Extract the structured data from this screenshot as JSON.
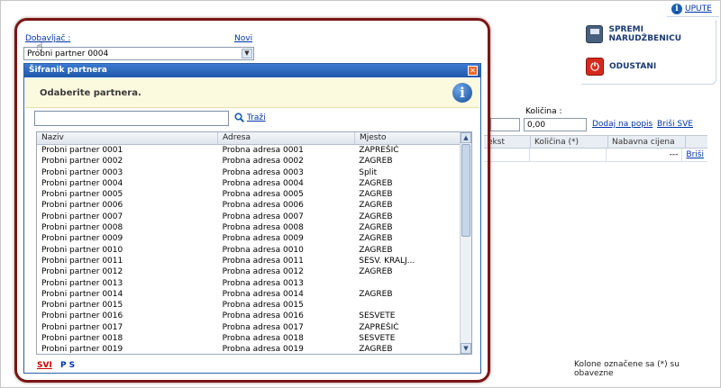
{
  "upute_label": "UPUTE",
  "actions": {
    "save_label": "SPREMI NARUDŽBENICU",
    "cancel_label": "ODUSTANI"
  },
  "quantity": {
    "label": "Količina :",
    "value": "0,00",
    "add_link": "Dodaj na popis",
    "delete_all_link": "Briši SVE"
  },
  "background_table": {
    "columns": [
      "ekst",
      "Količina (*)",
      "Nabavna cijena"
    ],
    "row_value": "---",
    "row_delete": "Briši"
  },
  "footer_note": "Kolone označene sa (*) su obavezne",
  "supplier": {
    "label": "Dobavljač :",
    "new_link": "Novi",
    "selected": "Probni partner 0004"
  },
  "dialog": {
    "title": "Šifranik partnera",
    "message": "Odaberite partnera.",
    "search_value": "",
    "search_button": "Traži",
    "columns": [
      "Naziv",
      "Adresa",
      "Mjesto"
    ],
    "rows": [
      [
        "Probni partner 0001",
        "Probna adresa 0001",
        "ZAPREŠIĆ"
      ],
      [
        "Probni partner 0002",
        "Probna adresa 0002",
        "ZAGREB"
      ],
      [
        "Probni partner 0003",
        "Probna adresa 0003",
        "Split"
      ],
      [
        "Probni partner 0004",
        "Probna adresa 0004",
        "ZAGREB"
      ],
      [
        "Probni partner 0005",
        "Probna adresa 0005",
        "ZAGREB"
      ],
      [
        "Probni partner 0006",
        "Probna adresa 0006",
        "ZAGREB"
      ],
      [
        "Probni partner 0007",
        "Probna adresa 0007",
        "ZAGREB"
      ],
      [
        "Probni partner 0008",
        "Probna adresa 0008",
        "ZAGREB"
      ],
      [
        "Probni partner 0009",
        "Probna adresa 0009",
        "ZAGREB"
      ],
      [
        "Probni partner 0010",
        "Probna adresa 0010",
        "ZAGREB"
      ],
      [
        "Probni partner 0011",
        "Probna adresa 0011",
        "SESV. KRALJ..."
      ],
      [
        "Probni partner 0012",
        "Probna adresa 0012",
        "ZAGREB"
      ],
      [
        "Probni partner 0013",
        "Probna adresa 0013",
        ""
      ],
      [
        "Probni partner 0014",
        "Probna adresa 0014",
        "ZAGREB"
      ],
      [
        "Probni partner 0015",
        "Probna adresa 0015",
        ""
      ],
      [
        "Probni partner 0016",
        "Probna adresa 0016",
        "SESVETE"
      ],
      [
        "Probni partner 0017",
        "Probna adresa 0017",
        "ZAPREŠIĆ"
      ],
      [
        "Probni partner 0018",
        "Probna adresa 0018",
        "SESVETE"
      ],
      [
        "Probni partner 0019",
        "Probna adresa 0019",
        "ZAGREB"
      ]
    ],
    "scroll_position": 0,
    "filter_all": "SVI",
    "filter_letters": "P S"
  }
}
